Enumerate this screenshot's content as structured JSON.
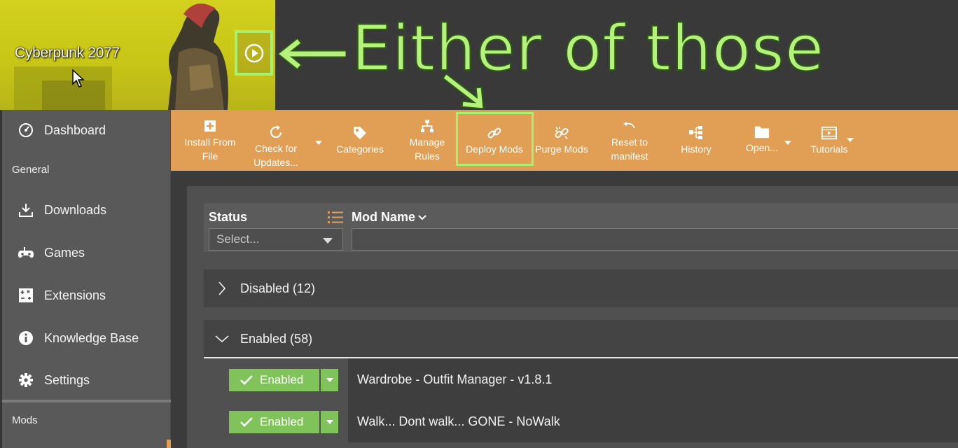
{
  "game": {
    "title": "Cyberpunk 2077"
  },
  "annotation": {
    "text": "Either of those"
  },
  "toolbar": {
    "items": [
      {
        "label": "Install From File",
        "icon": "install-file-icon"
      },
      {
        "label": "Check for Updates...",
        "icon": "refresh-icon"
      },
      {
        "label": "Categories",
        "icon": "tag-icon"
      },
      {
        "label": "Manage Rules",
        "icon": "sitemap-icon"
      },
      {
        "label": "Deploy Mods",
        "icon": "link-icon"
      },
      {
        "label": "Purge Mods",
        "icon": "broken-link-icon"
      },
      {
        "label": "Reset to manifest",
        "icon": "undo-icon"
      },
      {
        "label": "History",
        "icon": "history-icon"
      },
      {
        "label": "Open...",
        "icon": "folder-icon"
      },
      {
        "label": "Tutorials",
        "icon": "film-icon"
      }
    ]
  },
  "sidebar": {
    "dashboard": "Dashboard",
    "section_general": "General",
    "items": [
      {
        "label": "Downloads",
        "icon": "download-icon"
      },
      {
        "label": "Games",
        "icon": "gamepad-icon"
      },
      {
        "label": "Extensions",
        "icon": "puzzle-icon"
      },
      {
        "label": "Knowledge Base",
        "icon": "info-icon"
      },
      {
        "label": "Settings",
        "icon": "gear-icon"
      }
    ],
    "section_mods": "Mods"
  },
  "table": {
    "col_status": "Status",
    "col_mod_name": "Mod Name",
    "status_placeholder": "Select...",
    "groups": [
      {
        "label": "Disabled (12)",
        "expanded": false
      },
      {
        "label": "Enabled (58)",
        "expanded": true
      }
    ],
    "rows": [
      {
        "status": "Enabled",
        "name": "Wardrobe - Outfit Manager - v1.8.1"
      },
      {
        "status": "Enabled",
        "name": "Walk... Dont walk... GONE - NoWalk"
      }
    ]
  },
  "colors": {
    "toolbar": "#e19f55",
    "highlight": "#a8f070",
    "enabled": "#80c35a",
    "sidebar": "#595959"
  }
}
